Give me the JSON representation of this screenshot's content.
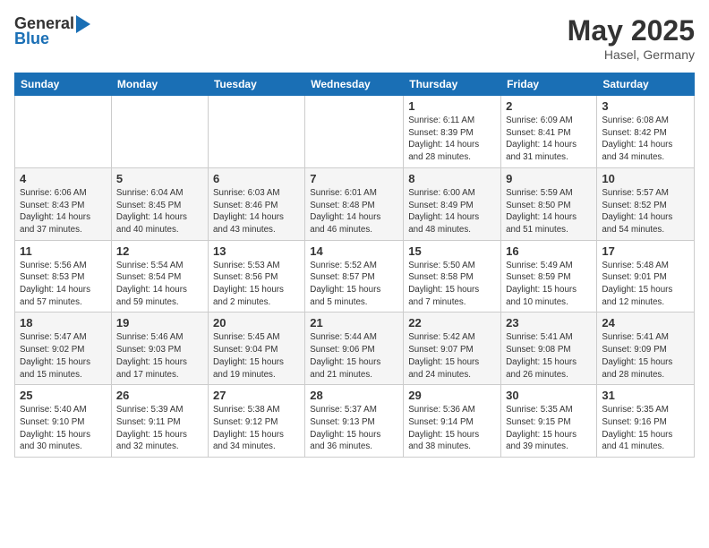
{
  "header": {
    "logo_general": "General",
    "logo_blue": "Blue",
    "month_year": "May 2025",
    "location": "Hasel, Germany"
  },
  "weekdays": [
    "Sunday",
    "Monday",
    "Tuesday",
    "Wednesday",
    "Thursday",
    "Friday",
    "Saturday"
  ],
  "rows": [
    [
      {
        "day": "",
        "info": ""
      },
      {
        "day": "",
        "info": ""
      },
      {
        "day": "",
        "info": ""
      },
      {
        "day": "",
        "info": ""
      },
      {
        "day": "1",
        "info": "Sunrise: 6:11 AM\nSunset: 8:39 PM\nDaylight: 14 hours\nand 28 minutes."
      },
      {
        "day": "2",
        "info": "Sunrise: 6:09 AM\nSunset: 8:41 PM\nDaylight: 14 hours\nand 31 minutes."
      },
      {
        "day": "3",
        "info": "Sunrise: 6:08 AM\nSunset: 8:42 PM\nDaylight: 14 hours\nand 34 minutes."
      }
    ],
    [
      {
        "day": "4",
        "info": "Sunrise: 6:06 AM\nSunset: 8:43 PM\nDaylight: 14 hours\nand 37 minutes."
      },
      {
        "day": "5",
        "info": "Sunrise: 6:04 AM\nSunset: 8:45 PM\nDaylight: 14 hours\nand 40 minutes."
      },
      {
        "day": "6",
        "info": "Sunrise: 6:03 AM\nSunset: 8:46 PM\nDaylight: 14 hours\nand 43 minutes."
      },
      {
        "day": "7",
        "info": "Sunrise: 6:01 AM\nSunset: 8:48 PM\nDaylight: 14 hours\nand 46 minutes."
      },
      {
        "day": "8",
        "info": "Sunrise: 6:00 AM\nSunset: 8:49 PM\nDaylight: 14 hours\nand 48 minutes."
      },
      {
        "day": "9",
        "info": "Sunrise: 5:59 AM\nSunset: 8:50 PM\nDaylight: 14 hours\nand 51 minutes."
      },
      {
        "day": "10",
        "info": "Sunrise: 5:57 AM\nSunset: 8:52 PM\nDaylight: 14 hours\nand 54 minutes."
      }
    ],
    [
      {
        "day": "11",
        "info": "Sunrise: 5:56 AM\nSunset: 8:53 PM\nDaylight: 14 hours\nand 57 minutes."
      },
      {
        "day": "12",
        "info": "Sunrise: 5:54 AM\nSunset: 8:54 PM\nDaylight: 14 hours\nand 59 minutes."
      },
      {
        "day": "13",
        "info": "Sunrise: 5:53 AM\nSunset: 8:56 PM\nDaylight: 15 hours\nand 2 minutes."
      },
      {
        "day": "14",
        "info": "Sunrise: 5:52 AM\nSunset: 8:57 PM\nDaylight: 15 hours\nand 5 minutes."
      },
      {
        "day": "15",
        "info": "Sunrise: 5:50 AM\nSunset: 8:58 PM\nDaylight: 15 hours\nand 7 minutes."
      },
      {
        "day": "16",
        "info": "Sunrise: 5:49 AM\nSunset: 8:59 PM\nDaylight: 15 hours\nand 10 minutes."
      },
      {
        "day": "17",
        "info": "Sunrise: 5:48 AM\nSunset: 9:01 PM\nDaylight: 15 hours\nand 12 minutes."
      }
    ],
    [
      {
        "day": "18",
        "info": "Sunrise: 5:47 AM\nSunset: 9:02 PM\nDaylight: 15 hours\nand 15 minutes."
      },
      {
        "day": "19",
        "info": "Sunrise: 5:46 AM\nSunset: 9:03 PM\nDaylight: 15 hours\nand 17 minutes."
      },
      {
        "day": "20",
        "info": "Sunrise: 5:45 AM\nSunset: 9:04 PM\nDaylight: 15 hours\nand 19 minutes."
      },
      {
        "day": "21",
        "info": "Sunrise: 5:44 AM\nSunset: 9:06 PM\nDaylight: 15 hours\nand 21 minutes."
      },
      {
        "day": "22",
        "info": "Sunrise: 5:42 AM\nSunset: 9:07 PM\nDaylight: 15 hours\nand 24 minutes."
      },
      {
        "day": "23",
        "info": "Sunrise: 5:41 AM\nSunset: 9:08 PM\nDaylight: 15 hours\nand 26 minutes."
      },
      {
        "day": "24",
        "info": "Sunrise: 5:41 AM\nSunset: 9:09 PM\nDaylight: 15 hours\nand 28 minutes."
      }
    ],
    [
      {
        "day": "25",
        "info": "Sunrise: 5:40 AM\nSunset: 9:10 PM\nDaylight: 15 hours\nand 30 minutes."
      },
      {
        "day": "26",
        "info": "Sunrise: 5:39 AM\nSunset: 9:11 PM\nDaylight: 15 hours\nand 32 minutes."
      },
      {
        "day": "27",
        "info": "Sunrise: 5:38 AM\nSunset: 9:12 PM\nDaylight: 15 hours\nand 34 minutes."
      },
      {
        "day": "28",
        "info": "Sunrise: 5:37 AM\nSunset: 9:13 PM\nDaylight: 15 hours\nand 36 minutes."
      },
      {
        "day": "29",
        "info": "Sunrise: 5:36 AM\nSunset: 9:14 PM\nDaylight: 15 hours\nand 38 minutes."
      },
      {
        "day": "30",
        "info": "Sunrise: 5:35 AM\nSunset: 9:15 PM\nDaylight: 15 hours\nand 39 minutes."
      },
      {
        "day": "31",
        "info": "Sunrise: 5:35 AM\nSunset: 9:16 PM\nDaylight: 15 hours\nand 41 minutes."
      }
    ]
  ]
}
